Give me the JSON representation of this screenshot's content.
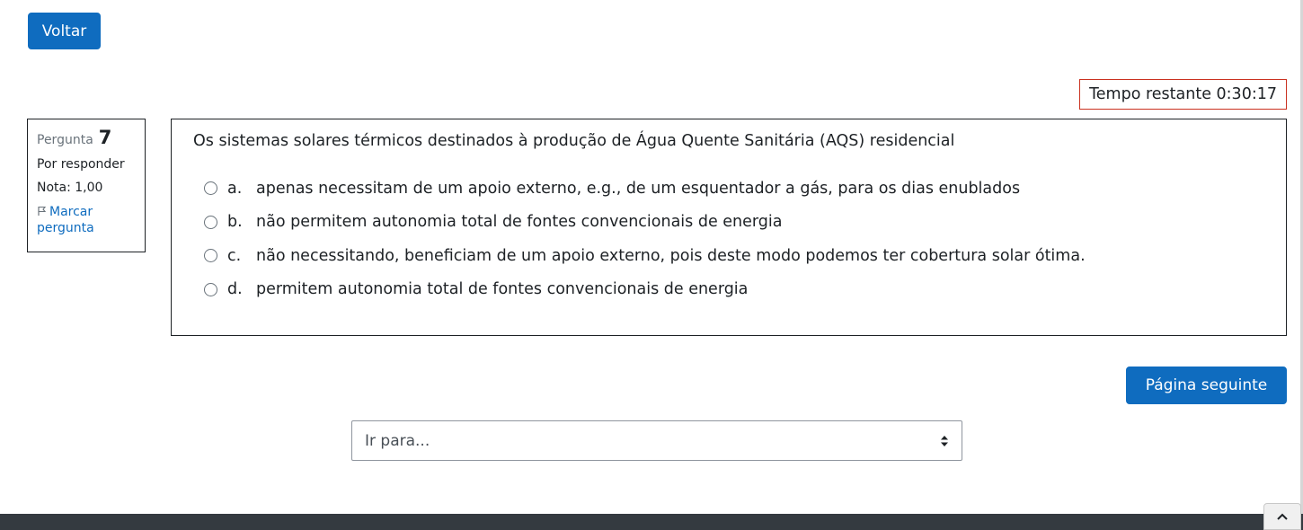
{
  "nav": {
    "back_label": "Voltar"
  },
  "timer": {
    "text": "Tempo restante 0:30:17"
  },
  "question_info": {
    "label": "Pergunta",
    "number": "7",
    "state": "Por responder",
    "grade": "Nota: 1,00",
    "flag_label": "Marcar pergunta",
    "flag_icon": "flag-icon"
  },
  "question": {
    "text": "Os sistemas solares térmicos destinados à produção de Água Quente Sanitária (AQS) residencial",
    "answers": [
      {
        "letter": "a.",
        "text": "apenas necessitam de um apoio externo, e.g., de um esquentador a gás, para os dias enublados"
      },
      {
        "letter": "b.",
        "text": "não permitem autonomia total de fontes convencionais de energia"
      },
      {
        "letter": "c.",
        "text": "não necessitando, beneficiam de um apoio externo, pois deste modo podemos ter cobertura solar ótima."
      },
      {
        "letter": "d.",
        "text": "permitem autonomia total de fontes convencionais de energia"
      }
    ]
  },
  "next_label": "Página seguinte",
  "jump": {
    "selected": "Ir para..."
  },
  "colors": {
    "primary": "#0f6cbf",
    "timer_border": "#ca3120",
    "footer": "#343a40"
  }
}
